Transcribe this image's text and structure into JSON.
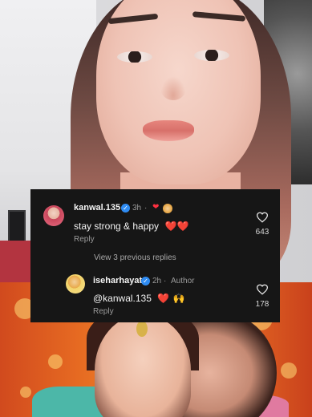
{
  "comment1": {
    "username": "kanwal.135",
    "time": "3h",
    "meta_sep": "·",
    "meta_emoji": "❤",
    "text": "stay strong & happy",
    "emoji": "❤️❤️",
    "reply_label": "Reply",
    "likes": "643"
  },
  "view_previous": "View 3 previous replies",
  "comment2": {
    "username": "iseharhayat",
    "time": "2h",
    "meta_sep": "·",
    "author_label": "Author",
    "text": "@kanwal.135",
    "emoji_heart": "❤️",
    "emoji_raise": "🙌",
    "reply_label": "Reply",
    "likes": "178"
  },
  "colors": {
    "panel": "#161616",
    "verified": "#2f8cf3",
    "heart": "#ff3040"
  },
  "icons": {
    "verified": "verified-badge-icon",
    "like": "heart-outline-icon"
  }
}
